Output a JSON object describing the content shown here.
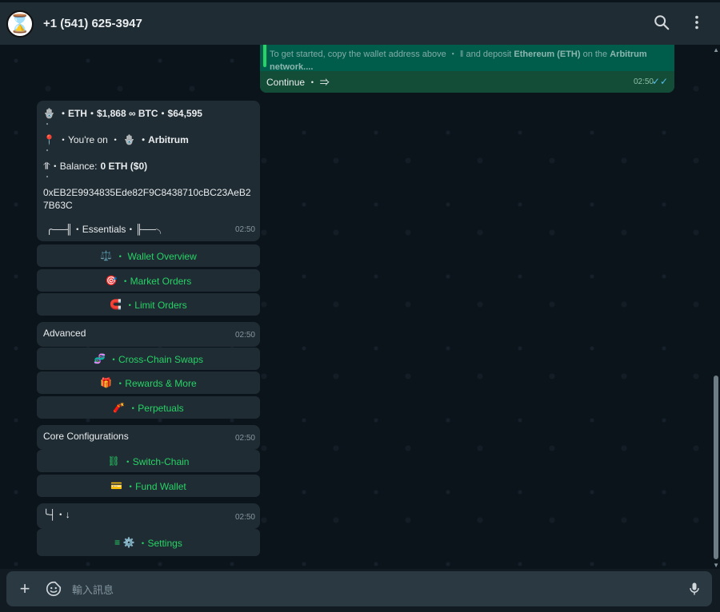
{
  "header": {
    "contact": "+1 (541) 625-3947",
    "avatar_glyph": "⌛"
  },
  "outgoing": {
    "quote_prefix": "To get started, copy the wallet address above",
    "quote_mid": " and deposit ",
    "quote_asset": "Ethereum (ETH)",
    "quote_on": " on the ",
    "quote_network": "Arbitrum",
    "quote_tail": "network....",
    "continue_label": "Continue ・ ⇒",
    "time": "02:50",
    "ticks": "✓✓"
  },
  "main_message": {
    "price_line": "・ETH・$1,868 ∞ BTC・$64,595",
    "dot1": "・",
    "chain_prefix": "・You're on ・",
    "chain_name": "・Arbitrum",
    "dot2": "・",
    "balance_prefix": "⥣・Balance: ",
    "balance_value": "0 ETH ($0)",
    "dot3": "・",
    "address": "0xEB2E9934835Ede82F9C8438710cBC23AeB27B63C",
    "essentials": "╭──╢・Essentials・╟──╮",
    "time": "02:50"
  },
  "essentials_buttons": [
    {
      "emoji": "⚖️",
      "label": "・ Wallet Overview"
    },
    {
      "emoji": "🎯",
      "label": "・Market Orders"
    },
    {
      "emoji": "🧲",
      "label": "・Limit Orders"
    }
  ],
  "advanced": {
    "title": "Advanced",
    "time": "02:50"
  },
  "advanced_buttons": [
    {
      "emoji": "🧬",
      "label": "・Cross-Chain Swaps"
    },
    {
      "emoji": "🎁",
      "label": "・Rewards & More"
    },
    {
      "emoji": "🧨",
      "label": "・Perpetuals"
    }
  ],
  "core": {
    "title": "Core Configurations",
    "time": "02:50"
  },
  "core_buttons": [
    {
      "emoji": "⛓",
      "label": "・Switch-Chain"
    },
    {
      "emoji": "💳",
      "label": "・Fund Wallet"
    }
  ],
  "footer_msg": {
    "text": "╰┤・↓",
    "time": "02:50"
  },
  "settings_button": {
    "emoji": "≡ ⚙️",
    "label": "・Settings"
  },
  "input": {
    "placeholder": "輸入訊息"
  },
  "colors": {
    "accent": "#25d366",
    "bubble_in": "#202c33",
    "bubble_out": "#005c4b",
    "bg": "#0b141a"
  }
}
